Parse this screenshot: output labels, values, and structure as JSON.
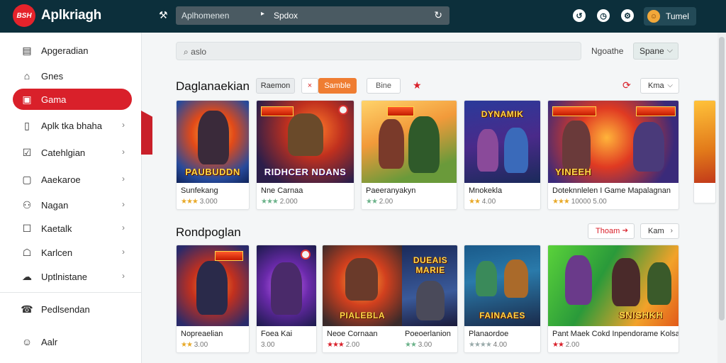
{
  "header": {
    "logo_text": "BSH",
    "brand": "Aplkriagh",
    "search_left": "Aplhomenen",
    "search_right": "Spdox",
    "user_name": "Tumel"
  },
  "sidebar": {
    "items": [
      {
        "label": "Apgeradian",
        "icon": "window-icon"
      },
      {
        "label": "Gnes",
        "icon": "home-icon"
      },
      {
        "label": "Gama",
        "icon": "gamepad-icon",
        "active": true
      },
      {
        "label": "Aplk tka bhaha",
        "icon": "document-icon"
      },
      {
        "label": "Catehlgian",
        "icon": "checklist-icon"
      },
      {
        "label": "Aaekaroe",
        "icon": "folder-icon"
      },
      {
        "label": "Nagan",
        "icon": "people-icon"
      },
      {
        "label": "Kaetalk",
        "icon": "bag-icon"
      },
      {
        "label": "Karlcen",
        "icon": "store-icon"
      },
      {
        "label": "Uptlnistane",
        "icon": "cloud-icon"
      },
      {
        "label": "Pedlsendan",
        "icon": "support-icon"
      },
      {
        "label": "Aalr",
        "icon": "user-icon"
      }
    ]
  },
  "main": {
    "search_placeholder": "aslo",
    "nav_label": "Ngoathe",
    "sort_value": "Spane",
    "section1": {
      "title": "Daglanaekian",
      "chip_filter": "Raemon",
      "chip_close": "×",
      "chip_active": "Samble",
      "chip_other": "Bine",
      "more_button": "Kma",
      "cards": [
        {
          "title": "Sunfekang",
          "rating": "3.000",
          "stars": "★★★",
          "art_text": "PAUBUDDN"
        },
        {
          "title": "Nne Carnaa",
          "rating": "2.000",
          "stars": "★★★",
          "art_text": "RIDHCER NDANS"
        },
        {
          "title": "Paeeranyakyn",
          "rating": "2.00",
          "stars": "★★",
          "art_text": ""
        },
        {
          "title": "Mnokekla",
          "rating": "4.00",
          "stars": "★★",
          "art_text": "DYNAMIK"
        },
        {
          "title": "Doteknnlelen I Game Mapalagnan",
          "rating": "10000 5.00",
          "stars": "★★★",
          "art_text": "YINEEH"
        }
      ]
    },
    "section2": {
      "title": "Rondpoglan",
      "red_button": "Thoam",
      "more_button": "Kam",
      "cards": [
        {
          "title": "Nopreaelian",
          "rating": "3.00",
          "stars": "★★",
          "art_text": ""
        },
        {
          "title": "Foea Kai",
          "rating": "3.00",
          "stars": "",
          "art_text": ""
        },
        {
          "title": "Neoe Cornaan",
          "rating": "2.00",
          "stars": "★★★",
          "art_text": "PIALEBLA"
        },
        {
          "title": "Poeoerlanion",
          "rating": "3.00",
          "stars": "★★",
          "art_text": "DUEAIS MARIE"
        },
        {
          "title": "Planaordoe",
          "rating": "4.00",
          "stars": "★★★★",
          "art_text": "FAINAAES"
        },
        {
          "title": "Pant Maek Cokd Inpendorame Kolsa",
          "rating": "2.00",
          "stars": "★★",
          "art_text": "SNISHKH"
        }
      ]
    }
  }
}
